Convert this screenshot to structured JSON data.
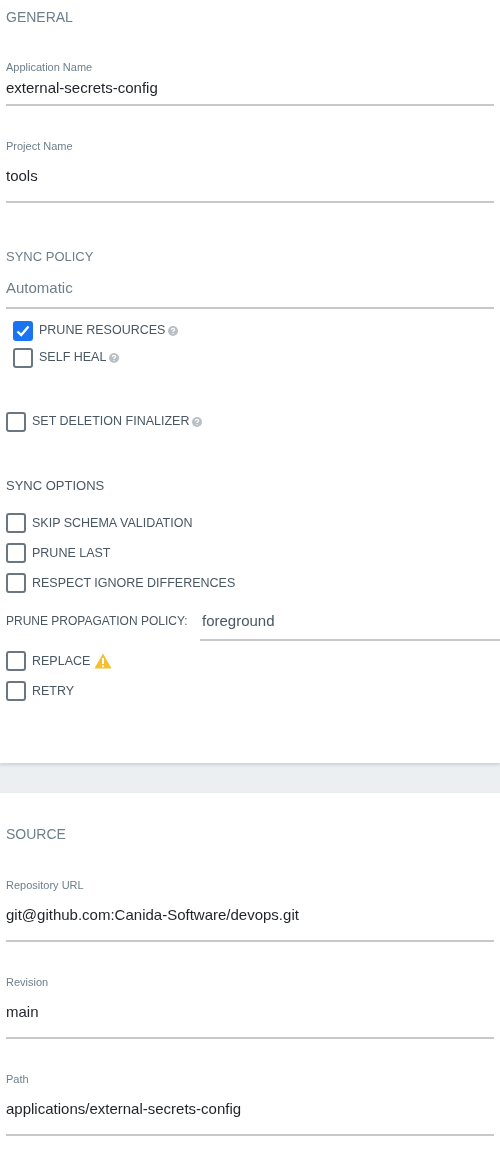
{
  "general": {
    "title": "GENERAL",
    "fields": [
      {
        "label": "Application Name",
        "value": "external-secrets-config"
      },
      {
        "label": "Project Name",
        "value": "tools"
      }
    ],
    "sync_policy": {
      "title": "SYNC POLICY",
      "value": "Automatic",
      "options": [
        {
          "label": "PRUNE RESOURCES",
          "checked": true,
          "has_help": true
        },
        {
          "label": "SELF HEAL",
          "checked": false,
          "has_help": true
        }
      ]
    },
    "finalizer": {
      "label": "SET DELETION FINALIZER",
      "checked": false,
      "has_help": true
    },
    "sync_options": {
      "title": "SYNC OPTIONS",
      "options": [
        {
          "label": "SKIP SCHEMA VALIDATION",
          "checked": false
        },
        {
          "label": "PRUNE LAST",
          "checked": false
        },
        {
          "label": "RESPECT IGNORE DIFFERENCES",
          "checked": false
        }
      ],
      "prune_propagation": {
        "label": "PRUNE PROPAGATION POLICY:",
        "value": "foreground"
      },
      "more_options": [
        {
          "label": "REPLACE",
          "checked": false,
          "has_warning": true
        },
        {
          "label": "RETRY",
          "checked": false
        }
      ]
    }
  },
  "source": {
    "title": "SOURCE",
    "fields": [
      {
        "label": "Repository URL",
        "value": "git@github.com:Canida-Software/devops.git"
      },
      {
        "label": "Revision",
        "value": "main"
      },
      {
        "label": "Path",
        "value": "applications/external-secrets-config"
      }
    ]
  }
}
